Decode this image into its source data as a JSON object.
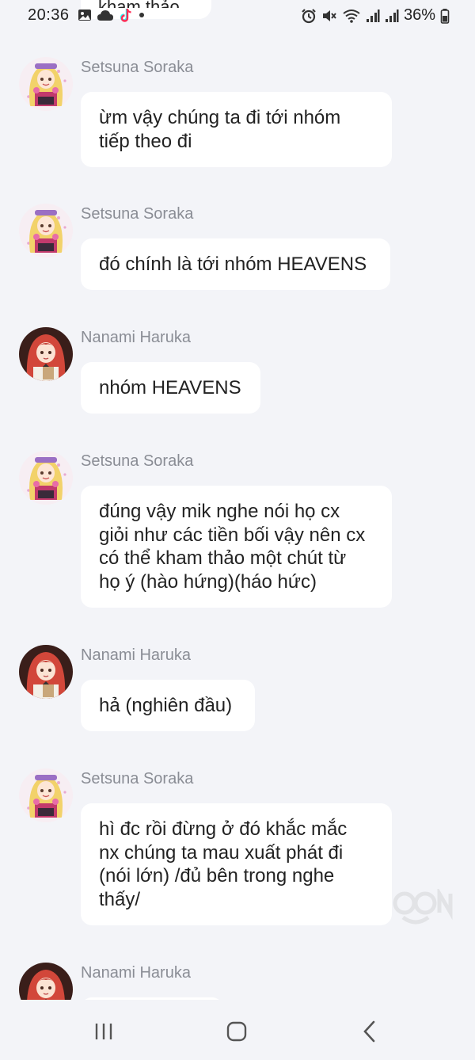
{
  "status_bar": {
    "time": "20:36",
    "battery": "36%",
    "left_icons": [
      "image-icon",
      "cloud-icon",
      "tiktok-icon",
      "dot-icon"
    ],
    "right_icons": [
      "alarm-icon",
      "mute-icon",
      "wifi-icon",
      "signal-icon",
      "signal-icon",
      "battery-icon"
    ]
  },
  "peek": {
    "text": "kham thảo"
  },
  "messages": [
    {
      "sender": "Setsuna Soraka",
      "text": "ừm vậy chúng ta đi tới nhóm\ntiếp theo đi",
      "avatar": "setsuna"
    },
    {
      "sender": "Setsuna Soraka",
      "text": "đó chính là tới nhóm HEAVENS",
      "avatar": "setsuna"
    },
    {
      "sender": "Nanami Haruka",
      "text": "nhóm HEAVENS",
      "avatar": "nanami"
    },
    {
      "sender": "Setsuna Soraka",
      "text": "đúng vậy mik nghe nói họ cx\ngiỏi như các tiền bối vậy nên cx\ncó thể kham thảo một chút từ\nhọ ý (hào hứng)(háo hức)",
      "avatar": "setsuna"
    },
    {
      "sender": "Nanami Haruka",
      "text": "hả (nghiên đầu)",
      "avatar": "nanami"
    },
    {
      "sender": "Setsuna Soraka",
      "text": "hì đc rồi đừng ở đó khắc mắc\nnx chúng ta mau xuất phát đi\n(nói lớn) /đủ bên trong nghe\nthấy/",
      "avatar": "setsuna"
    },
    {
      "sender": "Nanami Haruka",
      "text": "",
      "avatar": "nanami"
    }
  ],
  "nav": [
    "recent-apps-icon",
    "home-icon",
    "back-icon"
  ],
  "colors": {
    "background": "#f3f4f8",
    "bubble": "#ffffff",
    "sender": "#8a8d95",
    "text": "#222222"
  }
}
